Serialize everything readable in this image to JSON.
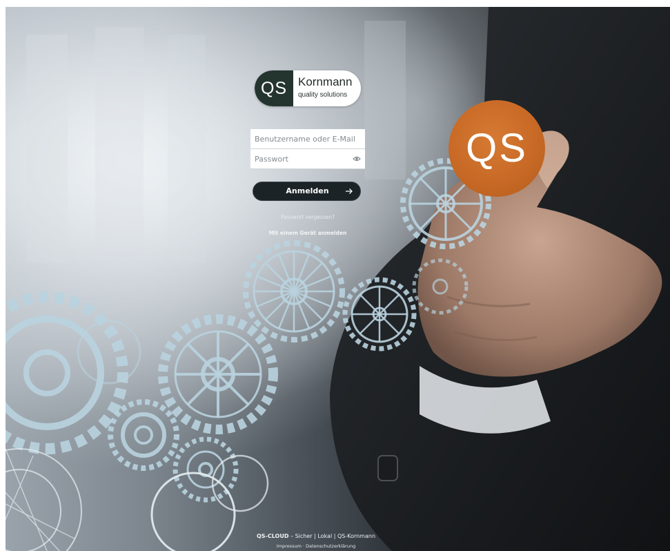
{
  "logo": {
    "mark": "QS",
    "name": "Kornmann",
    "tagline": "quality solutions"
  },
  "login": {
    "username_placeholder": "Benutzername oder E-Mail",
    "password_placeholder": "Passwort",
    "submit_label": "Anmelden",
    "forgot_password": "Passwort vergessen?",
    "device_login": "Mit einem Gerät anmelden"
  },
  "badge": {
    "text": "QS"
  },
  "footer": {
    "brand": "QS-CLOUD",
    "tagline": " – Sicher | Lokal | QS-Kornmann",
    "imprint": "Impressum",
    "separator": " · ",
    "privacy": "Datenschutzerklärung"
  },
  "colors": {
    "badge_orange": "#c86a26",
    "logo_green": "#24352f",
    "button_dark": "#1c2326"
  },
  "icons": {
    "password_toggle": "eye-icon",
    "submit": "arrow-right-icon"
  }
}
